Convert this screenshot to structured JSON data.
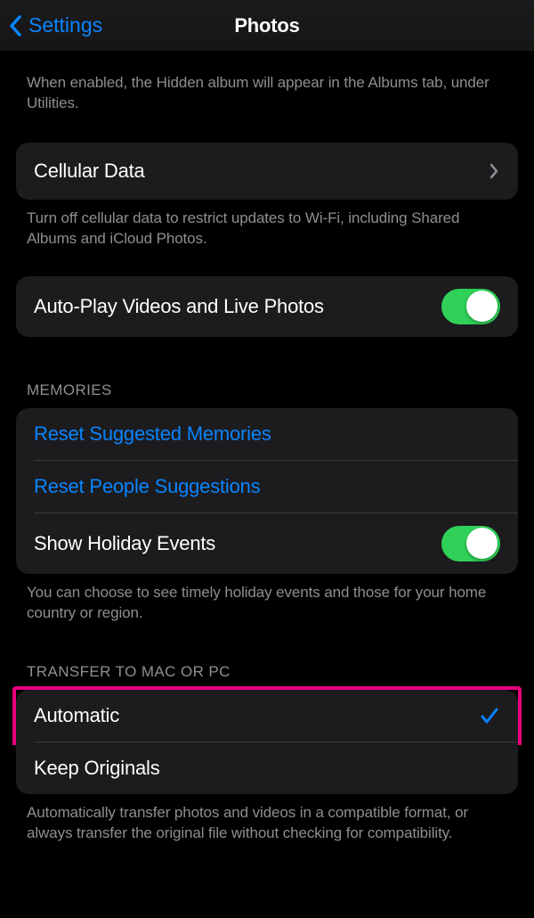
{
  "nav": {
    "back_label": "Settings",
    "title": "Photos"
  },
  "hidden_album": {
    "footer": "When enabled, the Hidden album will appear in the Albums tab, under Utilities."
  },
  "cellular": {
    "label": "Cellular Data",
    "footer": "Turn off cellular data to restrict updates to Wi-Fi, including Shared Albums and iCloud Photos."
  },
  "autoplay": {
    "label": "Auto-Play Videos and Live Photos"
  },
  "memories": {
    "header": "MEMORIES",
    "reset_suggested": "Reset Suggested Memories",
    "reset_people": "Reset People Suggestions",
    "holiday_label": "Show Holiday Events",
    "footer": "You can choose to see timely holiday events and those for your home country or region."
  },
  "transfer": {
    "header": "TRANSFER TO MAC OR PC",
    "automatic": "Automatic",
    "keep_originals": "Keep Originals",
    "footer": "Automatically transfer photos and videos in a compatible format, or always transfer the original file without checking for compatibility."
  }
}
